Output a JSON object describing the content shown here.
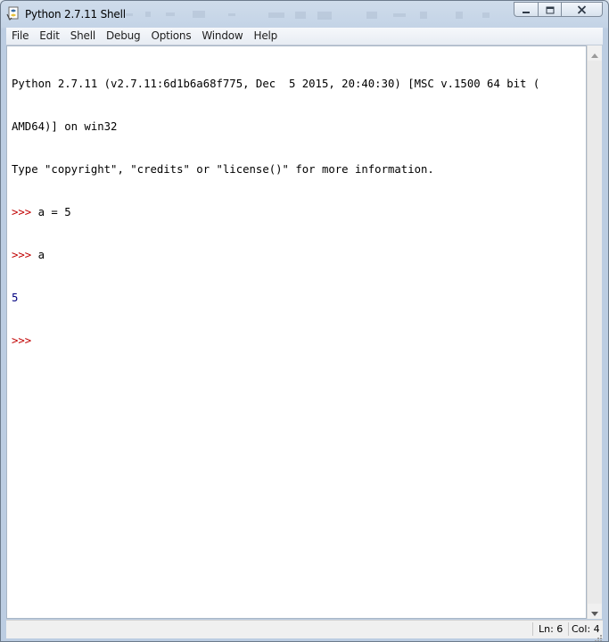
{
  "window": {
    "title": "Python 2.7.11 Shell"
  },
  "menu": {
    "items": [
      "File",
      "Edit",
      "Shell",
      "Debug",
      "Options",
      "Window",
      "Help"
    ]
  },
  "shell": {
    "lines": [
      {
        "kind": "plain",
        "text": "Python 2.7.11 (v2.7.11:6d1b6a68f775, Dec  5 2015, 20:40:30) [MSC v.1500 64 bit ("
      },
      {
        "kind": "plain",
        "text": "AMD64)] on win32"
      },
      {
        "kind": "plain",
        "text": "Type \"copyright\", \"credits\" or \"license()\" for more information."
      },
      {
        "kind": "input",
        "prompt": ">>> ",
        "text": "a = 5"
      },
      {
        "kind": "input",
        "prompt": ">>> ",
        "text": "a"
      },
      {
        "kind": "stdout",
        "text": "5"
      },
      {
        "kind": "input",
        "prompt": ">>> ",
        "text": ""
      }
    ]
  },
  "status": {
    "line": "Ln: 6",
    "col": "Col: 4"
  },
  "icons": {
    "app": "python-idle-icon",
    "minimize": "minimize-icon",
    "maximize": "maximize-icon",
    "close": "close-icon",
    "scroll_up": "scroll-up-arrow-icon",
    "scroll_down": "scroll-down-arrow-icon"
  },
  "colors": {
    "prompt": "#c00000",
    "stdout": "#000080",
    "text": "#000000"
  }
}
